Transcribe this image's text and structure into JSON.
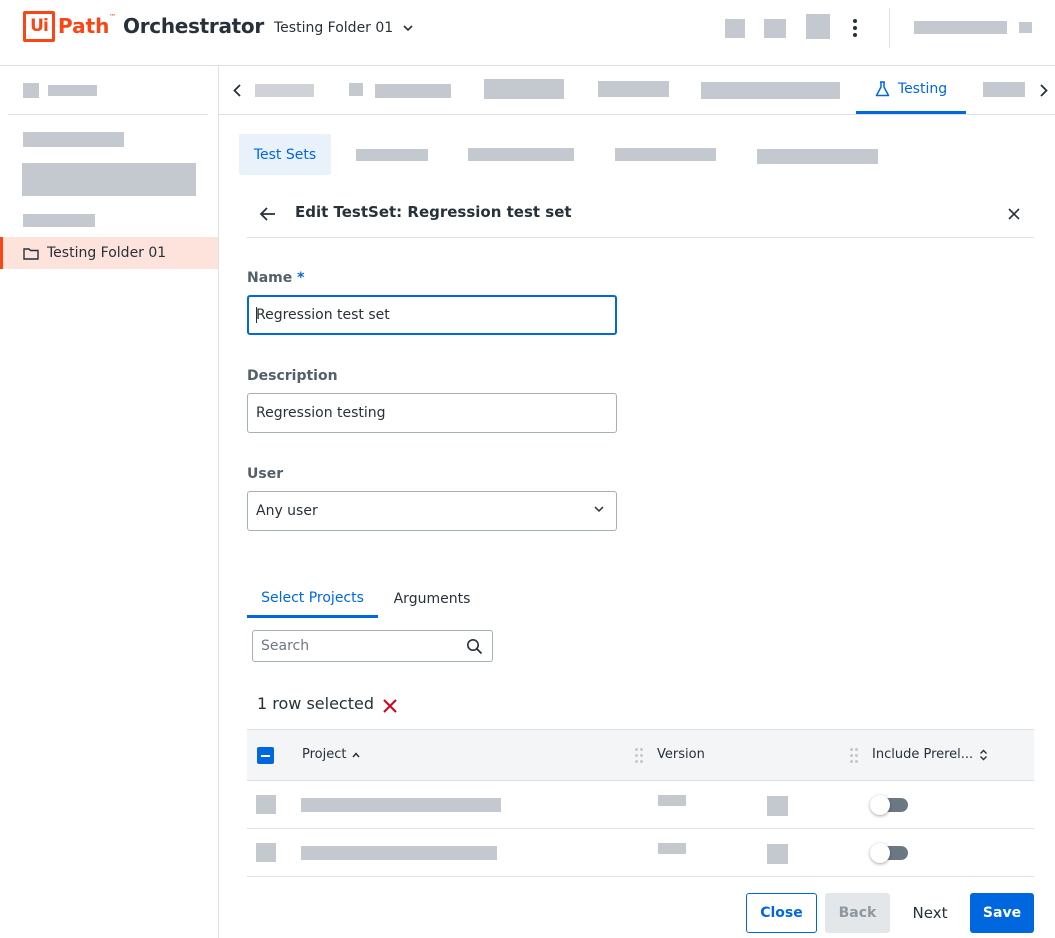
{
  "header": {
    "logo_ui": "Ui",
    "logo_path": "Path",
    "logo_tm": "™",
    "product": "Orchestrator",
    "folder": "Testing Folder 01"
  },
  "sidebar": {
    "selected_folder": "Testing Folder 01"
  },
  "tabs": {
    "active": "Testing"
  },
  "subtabs": {
    "active": "Test Sets"
  },
  "editor": {
    "title": "Edit TestSet: Regression test set",
    "name_label": "Name",
    "name_required": "*",
    "name_value": "Regression test set",
    "description_label": "Description",
    "description_value": "Regression testing",
    "user_label": "User",
    "user_value": "Any user"
  },
  "inner_tabs": {
    "select_projects": "Select Projects",
    "arguments": "Arguments",
    "active": "Select Projects"
  },
  "search": {
    "placeholder": "Search"
  },
  "selection": {
    "text": "1 row selected"
  },
  "table": {
    "columns": [
      "Project",
      "Version",
      "Include Prerel..."
    ],
    "rows": [
      {
        "include_prerelease": false
      },
      {
        "include_prerelease": false
      }
    ]
  },
  "footer": {
    "close": "Close",
    "back": "Back",
    "next": "Next",
    "save": "Save"
  },
  "colors": {
    "brand": "#fa4616",
    "accent": "#0067df",
    "danger": "#d0021b"
  },
  "icons": [
    "chevron-down-icon",
    "more-vert-icon",
    "folder-icon",
    "chevron-left-icon",
    "chevron-right-icon",
    "flask-icon",
    "arrow-back-icon",
    "close-icon",
    "search-icon",
    "sort-asc-icon",
    "sort-icon",
    "drag-handle-icon"
  ]
}
